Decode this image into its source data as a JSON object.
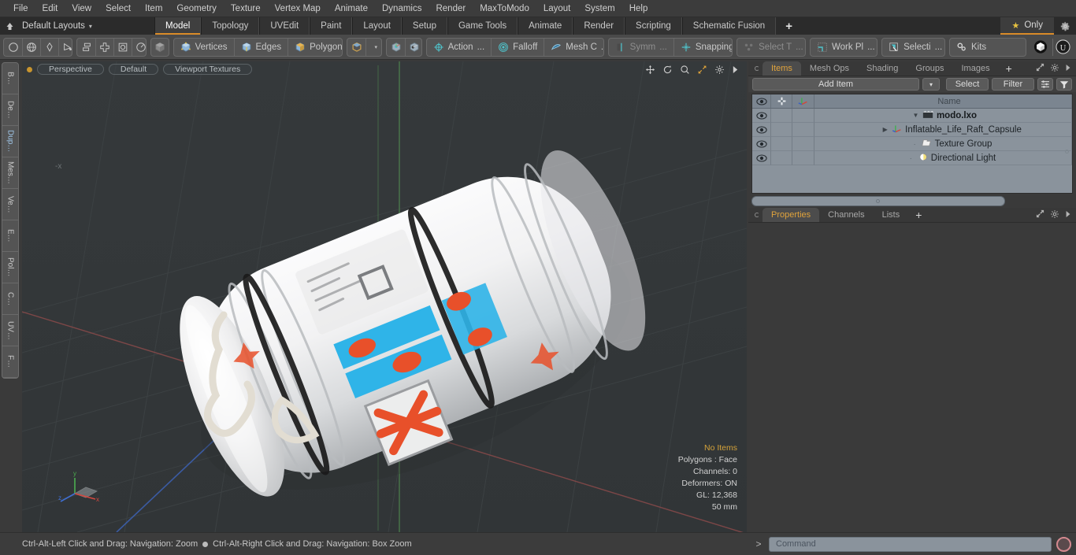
{
  "menubar": {
    "items": [
      {
        "label": "File"
      },
      {
        "label": "Edit"
      },
      {
        "label": "View"
      },
      {
        "label": "Select"
      },
      {
        "label": "Item"
      },
      {
        "label": "Geometry"
      },
      {
        "label": "Texture"
      },
      {
        "label": "Vertex Map"
      },
      {
        "label": "Animate"
      },
      {
        "label": "Dynamics"
      },
      {
        "label": "Render"
      },
      {
        "label": "MaxToModo"
      },
      {
        "label": "Layout"
      },
      {
        "label": "System"
      },
      {
        "label": "Help"
      }
    ]
  },
  "layoutbar": {
    "home_icon": "home-icon",
    "layout_name": "Default Layouts",
    "caret": "▾",
    "tabs": [
      {
        "label": "Model",
        "active": true
      },
      {
        "label": "Topology",
        "active": false
      },
      {
        "label": "UVEdit",
        "active": false
      },
      {
        "label": "Paint",
        "active": false
      },
      {
        "label": "Layout",
        "active": false
      },
      {
        "label": "Setup",
        "active": false
      },
      {
        "label": "Game Tools",
        "active": false
      },
      {
        "label": "Animate",
        "active": false
      },
      {
        "label": "Render",
        "active": false
      },
      {
        "label": "Scripting",
        "active": false
      },
      {
        "label": "Schematic Fusion",
        "active": false
      }
    ],
    "add_tab_label": "+",
    "only_label": "Only",
    "only_star": "★",
    "settings_icon": "gear-icon",
    "accent_color": "#d98b28"
  },
  "toolbar": {
    "primitive_group": [
      {
        "name": "circle-primitive-icon"
      },
      {
        "name": "sphere-primitive-icon"
      },
      {
        "name": "pen-tool-icon"
      },
      {
        "name": "curve-tool-icon"
      }
    ],
    "arrange_group": [
      {
        "name": "align-icon"
      },
      {
        "name": "center-icon"
      },
      {
        "name": "frame-icon"
      },
      {
        "name": "radial-icon"
      }
    ],
    "selection_mode_label": "",
    "selection_modes": [
      {
        "label": "Vertices",
        "name": "vertices-mode"
      },
      {
        "label": "Edges",
        "name": "edges-mode"
      },
      {
        "label": "Polygons",
        "name": "polygons-mode"
      }
    ],
    "items_dropdown": {
      "name": "items-mode",
      "caret": "▾"
    },
    "workplane_icons": [
      {
        "name": "center-pivot-icon"
      },
      {
        "name": "element-pivot-icon"
      }
    ],
    "modifiers": [
      {
        "label": "Action",
        "suffix": "...",
        "name": "action-center",
        "icon": "action-center-icon"
      },
      {
        "label": "Falloff",
        "suffix": "",
        "name": "falloff",
        "icon": "falloff-icon"
      },
      {
        "label": "Mesh C",
        "suffix": "...",
        "name": "mesh-constraint",
        "icon": "mesh-constraint-icon"
      }
    ],
    "symmetry": {
      "label": "Symm",
      "suffix": "...",
      "name": "symmetry",
      "icon": "symmetry-icon"
    },
    "snapping": {
      "label": "Snapping",
      "name": "snapping",
      "icon": "snapping-icon"
    },
    "select_through": {
      "label": "Select T",
      "suffix": "...",
      "name": "select-through",
      "icon": "select-through-icon",
      "disabled": true
    },
    "work_plane": {
      "label": "Work Pl",
      "suffix": "...",
      "name": "work-plane",
      "icon": "work-plane-icon"
    },
    "selection_set": {
      "label": "Selecti",
      "suffix": "...",
      "name": "selection-sets",
      "icon": "selection-sets-icon"
    },
    "kits": {
      "label": "Kits",
      "name": "kits",
      "icon": "kits-icon"
    },
    "right_icons": [
      {
        "name": "modo-bridge-icon"
      },
      {
        "name": "unreal-engine-icon"
      }
    ]
  },
  "left_tabs": [
    {
      "label": "B…"
    },
    {
      "label": "De…"
    },
    {
      "label": "Dup…",
      "selected": true
    },
    {
      "label": "Mes…"
    },
    {
      "label": "Ve…"
    },
    {
      "label": "E…"
    },
    {
      "label": "Pol…"
    },
    {
      "label": "C…"
    },
    {
      "label": "UV…"
    },
    {
      "label": "F…"
    }
  ],
  "viewport": {
    "view_label": "Perspective",
    "style_label": "Default",
    "shading_label": "Viewport Textures",
    "corner_icons": [
      {
        "name": "pan-icon"
      },
      {
        "name": "rotate-icon"
      },
      {
        "name": "zoom-icon"
      },
      {
        "name": "fit-icon"
      },
      {
        "name": "viewport-settings-icon"
      },
      {
        "name": "viewport-menu-icon"
      }
    ],
    "axis_label": "-x",
    "stats": {
      "selection": "No Items",
      "polygons": "Polygons : Face",
      "channels": "Channels: 0",
      "deformers": "Deformers: ON",
      "gl": "GL: 12,368",
      "scale": "50 mm"
    },
    "gizmo": {
      "x": "x",
      "y": "y",
      "z": "z"
    },
    "background_color": "#333739"
  },
  "items_panel": {
    "tabs": [
      {
        "label": "Items",
        "active": true
      },
      {
        "label": "Mesh Ops",
        "active": false
      },
      {
        "label": "Shading",
        "active": false
      },
      {
        "label": "Groups",
        "active": false
      },
      {
        "label": "Images",
        "active": false
      }
    ],
    "add_tab_label": "+",
    "add_item_label": "Add Item",
    "add_item_caret": "▾",
    "select_label": "Select",
    "filter_label": "Filter",
    "columns": [
      "",
      "",
      "",
      "Name"
    ],
    "name_column_label": "Name",
    "rows": [
      {
        "name": "modo.lxo",
        "level": 0,
        "icon": "scene-icon",
        "expander": "▼",
        "bold": true
      },
      {
        "name": "Inflatable_Life_Raft_Capsule",
        "level": 1,
        "icon": "mesh-icon",
        "expander": "▶",
        "bold": false
      },
      {
        "name": "Texture Group",
        "level": 1,
        "icon": "texture-group-icon",
        "expander": "",
        "bold": false
      },
      {
        "name": "Directional Light",
        "level": 1,
        "icon": "light-icon",
        "expander": "",
        "bold": false
      }
    ]
  },
  "properties_panel": {
    "tabs": [
      {
        "label": "Properties",
        "active": true
      },
      {
        "label": "Channels",
        "active": false
      },
      {
        "label": "Lists",
        "active": false
      }
    ],
    "add_tab_label": "+"
  },
  "statusbar": {
    "hint_left": "Ctrl-Alt-Left Click and Drag: Navigation: Zoom",
    "hint_right": "Ctrl-Alt-Right Click and Drag: Navigation: Box Zoom",
    "command_prompt": ">",
    "command_placeholder": "Command",
    "record_icon": "record-icon"
  }
}
